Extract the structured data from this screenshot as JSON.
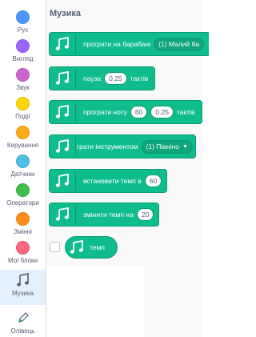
{
  "categories": [
    {
      "label": "Рух",
      "color": "#4c97ff",
      "name": "category-motion"
    },
    {
      "label": "Вигляд",
      "color": "#9966ff",
      "name": "category-looks"
    },
    {
      "label": "Звук",
      "color": "#cf63cf",
      "name": "category-sound"
    },
    {
      "label": "Події",
      "color": "#ffd500",
      "name": "category-events"
    },
    {
      "label": "Керування",
      "color": "#ffab19",
      "name": "category-control"
    },
    {
      "label": "Датчики",
      "color": "#4cbfe6",
      "name": "category-sensing"
    },
    {
      "label": "Оператори",
      "color": "#40bf4a",
      "name": "category-operators"
    },
    {
      "label": "Змінні",
      "color": "#ff8c1a",
      "name": "category-variables"
    },
    {
      "label": "Мої блоки",
      "color": "#ff6680",
      "name": "category-my-blocks"
    }
  ],
  "music_category": {
    "label": "Музика",
    "icon": "music-notes-icon"
  },
  "pen_category": {
    "label": "Олівець",
    "icon": "pencil-icon"
  },
  "palette": {
    "title": "Музика",
    "blocks": {
      "drum": {
        "text": "програти на барабані",
        "dropdown": "(1) Малий ба"
      },
      "rest": {
        "text1": "пауза",
        "value": "0.25",
        "text2": "тактів"
      },
      "note": {
        "text1": "програти ноту",
        "note": "60",
        "beats": "0.25",
        "text2": "тактів"
      },
      "instrument": {
        "text": "грати інструментом",
        "dropdown": "(1) Піаніно"
      },
      "set_tempo": {
        "text": "встановити темп в",
        "value": "60"
      },
      "change_tempo": {
        "text": "змінити темп на",
        "value": "20"
      },
      "tempo": {
        "text": "темп"
      }
    }
  },
  "colors": {
    "music_block": "#0fbd8c",
    "music_border": "#0b9a73",
    "selected_bg": "#e5f0ff"
  }
}
